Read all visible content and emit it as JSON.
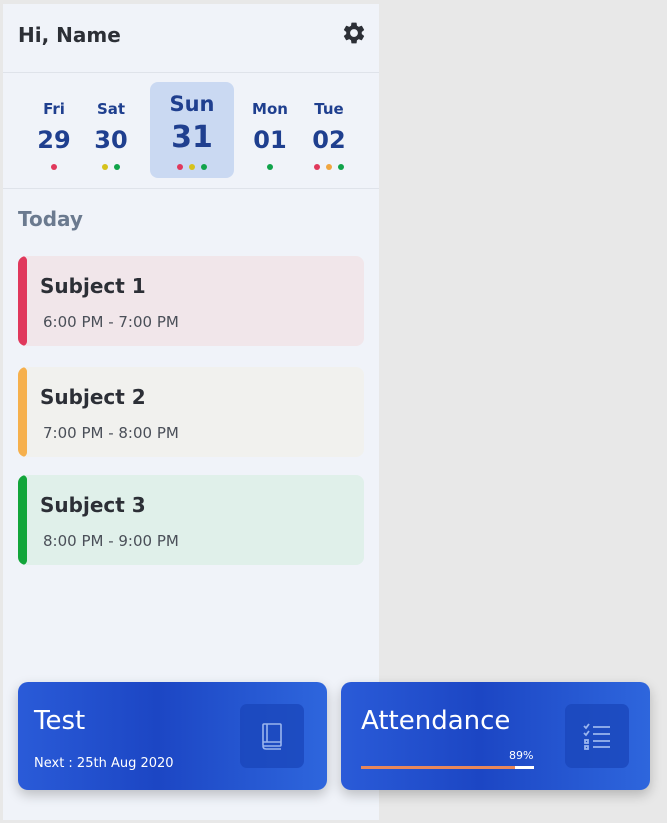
{
  "header": {
    "greeting": "Hi, Name",
    "settings_icon": "gear-icon"
  },
  "dates": [
    {
      "day": "Fri",
      "num": "29",
      "dots": [
        "#e0385c"
      ]
    },
    {
      "day": "Sat",
      "num": "30",
      "dots": [
        "#d6c21b",
        "#10a34a"
      ]
    },
    {
      "day": "Sun",
      "num": "31",
      "dots": [
        "#e0385c",
        "#d6c21b",
        "#10a34a"
      ],
      "selected": true
    },
    {
      "day": "Mon",
      "num": "01",
      "dots": [
        "#10a34a"
      ]
    },
    {
      "day": "Tue",
      "num": "02",
      "dots": [
        "#e0385c",
        "#f0a640",
        "#10a34a"
      ]
    }
  ],
  "section": {
    "today": "Today"
  },
  "subjects": [
    {
      "title": "Subject 1",
      "time": "6:00 PM - 7:00 PM",
      "accent": "#e0385c",
      "bg": "#f1e6ea"
    },
    {
      "title": "Subject 2",
      "time": "7:00 PM - 8:00 PM",
      "accent": "#f6b04d",
      "bg": "#f1f1ee"
    },
    {
      "title": "Subject 3",
      "time": "8:00 PM - 9:00 PM",
      "accent": "#12a53a",
      "bg": "#e0f0ea"
    }
  ],
  "test_tile": {
    "title": "Test",
    "subtitle": "Next : 25th Aug 2020",
    "icon": "book-icon"
  },
  "attendance_tile": {
    "title": "Attendance",
    "percent_label": "89%",
    "progress": 0.89,
    "icon": "checklist-icon"
  },
  "colors": {
    "primary": "#1f3f8f",
    "tile_blue": "#2458d6",
    "progress": "#e8875a"
  }
}
